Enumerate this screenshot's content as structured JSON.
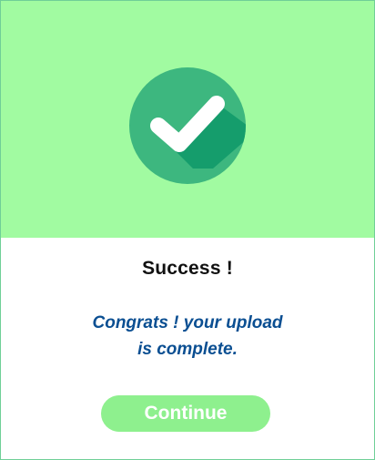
{
  "hero": {
    "icon": "check-circle-icon",
    "background_color": "#a1fba1",
    "circle_color": "#3db77f",
    "check_color": "#ffffff"
  },
  "dialog": {
    "title": "Success !",
    "message_line1": "Congrats ! your upload",
    "message_line2": "is complete."
  },
  "actions": {
    "continue_label": "Continue",
    "continue_color": "#8ef08e"
  }
}
